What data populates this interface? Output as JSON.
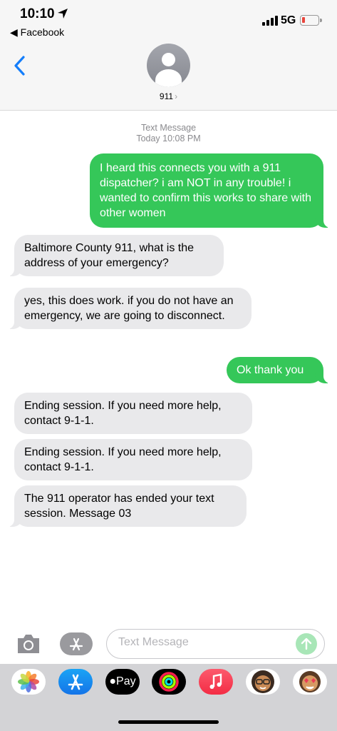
{
  "status_bar": {
    "time": "10:10",
    "back_app": "◀ Facebook",
    "network": "5G"
  },
  "header": {
    "contact_name": "911",
    "contact_chevron": "›"
  },
  "thread": {
    "service_label": "Text Message",
    "timestamp": "Today 10:08 PM"
  },
  "messages": [
    {
      "direction": "outgoing",
      "text": "I heard this connects you with a 911 dispatcher? i am NOT in any trouble! i wanted to confirm this works to share with other women"
    },
    {
      "direction": "incoming",
      "text": "Baltimore County 911, what is the address of your emergency?"
    },
    {
      "direction": "incoming",
      "text": "yes, this does work. if you do not have an emergency, we are going to disconnect."
    },
    {
      "direction": "outgoing",
      "text": "Ok thank you"
    },
    {
      "direction": "incoming",
      "text": "Ending session. If you need more help, contact 9-1-1."
    },
    {
      "direction": "incoming",
      "text": "Ending session. If you need more help, contact 9-1-1."
    },
    {
      "direction": "incoming",
      "text": "The 911 operator has ended your text session. Message 03"
    }
  ],
  "composer": {
    "placeholder": "Text Message",
    "value": ""
  },
  "app_drawer": {
    "apple_pay_label": "Pay",
    "icons": [
      "photos-icon",
      "app-store-icon",
      "apple-pay-icon",
      "activity-icon",
      "music-icon",
      "memoji-icon",
      "memoji-stickers-icon"
    ]
  },
  "colors": {
    "outgoing_bubble": "#35c759",
    "incoming_bubble": "#e9e9eb",
    "accent_blue": "#147efb",
    "battery_low": "#e8453c"
  }
}
